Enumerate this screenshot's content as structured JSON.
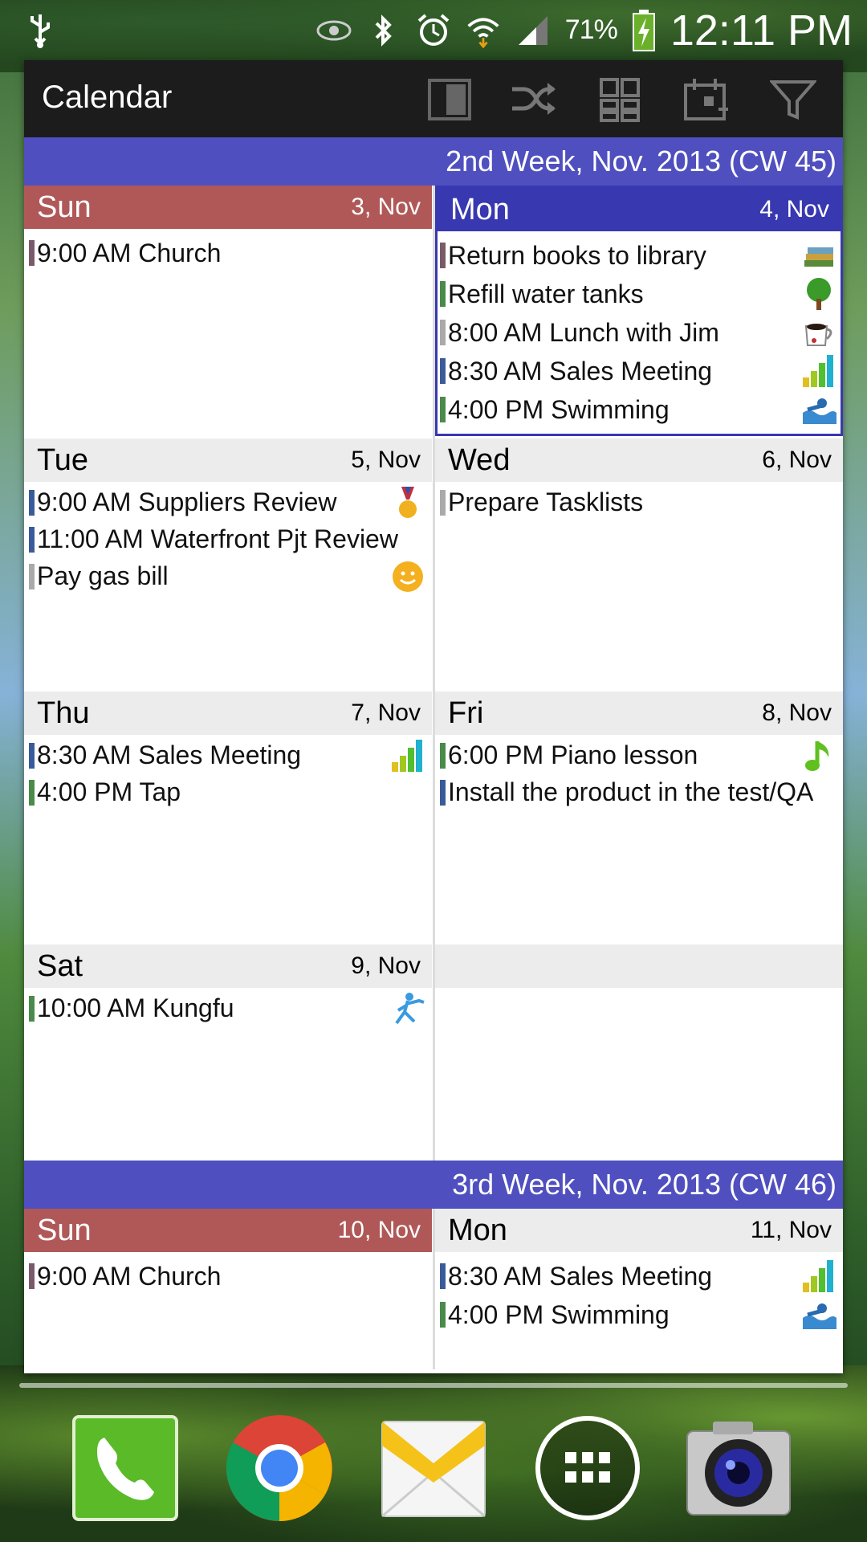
{
  "status_bar": {
    "battery_percent": "71%",
    "time": "12:11 PM",
    "icons": [
      "usb-icon",
      "eye-icon",
      "bluetooth-icon",
      "alarm-icon",
      "wifi-icon",
      "signal-icon",
      "battery-charging-icon"
    ]
  },
  "toolbar": {
    "title": "Calendar",
    "buttons": [
      "view-mode-icon",
      "shuffle-icon",
      "grid-icon",
      "calendar-today-icon",
      "filter-icon"
    ]
  },
  "weeks": [
    {
      "label": "2nd Week, Nov. 2013 (CW 45)",
      "days": [
        {
          "name": "Sun",
          "date": "3, Nov",
          "events": [
            {
              "text": "9:00 AM Church",
              "color": "#7a5a6a"
            }
          ]
        },
        {
          "name": "Mon",
          "date": "4, Nov",
          "today": true,
          "events": [
            {
              "text": "Return books to library",
              "color": "#7a5a6a",
              "icon": "books-icon"
            },
            {
              "text": "Refill water tanks",
              "color": "#4a8a4a",
              "icon": "tree-icon"
            },
            {
              "text": "8:00 AM Lunch with Jim",
              "color": "#aaaaaa",
              "icon": "coffee-cup-icon"
            },
            {
              "text": "8:30 AM Sales Meeting",
              "color": "#3a5a9a",
              "icon": "bar-chart-icon"
            },
            {
              "text": "4:00 PM Swimming",
              "color": "#4a8a4a",
              "icon": "swimming-icon"
            }
          ]
        },
        {
          "name": "Tue",
          "date": "5, Nov",
          "events": [
            {
              "text": "9:00 AM Suppliers Review",
              "color": "#3a5a9a",
              "icon": "medal-icon"
            },
            {
              "text": "11:00 AM Waterfront Pjt Review",
              "color": "#3a5a9a"
            },
            {
              "text": "Pay gas bill",
              "color": "#aaaaaa",
              "icon": "smiley-icon"
            }
          ]
        },
        {
          "name": "Wed",
          "date": "6, Nov",
          "events": [
            {
              "text": "Prepare Tasklists",
              "color": "#aaaaaa"
            }
          ]
        },
        {
          "name": "Thu",
          "date": "7, Nov",
          "events": [
            {
              "text": "8:30 AM Sales Meeting",
              "color": "#3a5a9a",
              "icon": "bar-chart-icon"
            },
            {
              "text": "4:00 PM Tap",
              "color": "#4a8a4a"
            }
          ]
        },
        {
          "name": "Fri",
          "date": "8, Nov",
          "events": [
            {
              "text": "6:00 PM Piano lesson",
              "color": "#4a8a4a",
              "icon": "music-note-icon"
            },
            {
              "text": "Install the product in the test/QA",
              "color": "#3a5a9a"
            }
          ]
        },
        {
          "name": "Sat",
          "date": "9, Nov",
          "events": [
            {
              "text": "10:00 AM Kungfu",
              "color": "#4a8a4a",
              "icon": "kungfu-icon"
            }
          ]
        }
      ]
    },
    {
      "label": "3rd Week, Nov. 2013 (CW 46)",
      "days": [
        {
          "name": "Sun",
          "date": "10, Nov",
          "events": [
            {
              "text": "9:00 AM Church",
              "color": "#7a5a6a"
            }
          ]
        },
        {
          "name": "Mon",
          "date": "11, Nov",
          "events": [
            {
              "text": "8:30 AM Sales Meeting",
              "color": "#3a5a9a",
              "icon": "bar-chart-icon"
            },
            {
              "text": "4:00 PM Swimming",
              "color": "#4a8a4a",
              "icon": "swimming-icon"
            }
          ]
        }
      ]
    }
  ],
  "dock": [
    "phone-icon",
    "chrome-icon",
    "email-icon",
    "apps-icon",
    "camera-icon"
  ]
}
